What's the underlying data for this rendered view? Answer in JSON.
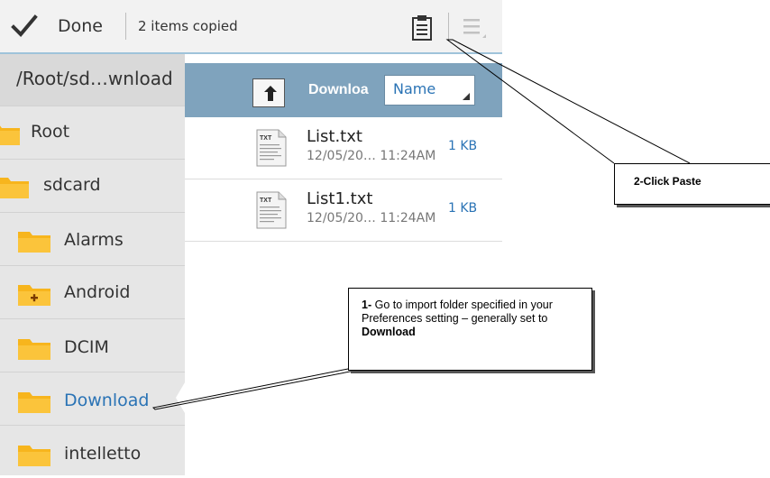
{
  "toolbar": {
    "done_label": "Done",
    "status": "2 items copied",
    "icons": [
      "checkmark-icon",
      "clipboard-paste-icon",
      "menu-icon"
    ]
  },
  "sidebar": {
    "path": "/Root/sd…wnload",
    "items": [
      {
        "label": "Root",
        "icon": "folder-icon"
      },
      {
        "label": "sdcard",
        "icon": "folder-icon"
      },
      {
        "label": "Alarms",
        "icon": "folder-icon"
      },
      {
        "label": "Android",
        "icon": "folder-plus-icon"
      },
      {
        "label": "DCIM",
        "icon": "folder-icon"
      },
      {
        "label": "Download",
        "icon": "folder-icon",
        "selected": true
      },
      {
        "label": "intelletto",
        "icon": "folder-icon"
      }
    ]
  },
  "content": {
    "folder_name": "Downloa",
    "sort": "Name",
    "files": [
      {
        "name": "List.txt",
        "date": "12/05/20… 11:24AM",
        "size": "1 KB",
        "icon_label": "TXT"
      },
      {
        "name": "List1.txt",
        "date": "12/05/20… 11:24AM",
        "size": "1 KB",
        "icon_label": "TXT"
      }
    ]
  },
  "callouts": {
    "paste": "2-Click Paste",
    "import_prefix": "1-",
    "import_body": " Go to import folder specified in your Preferences setting – generally set to ",
    "import_bold": "Download"
  },
  "colors": {
    "accent": "#2a73b5",
    "header_bar": "#7fa3bd",
    "toolbar_bg": "#f2f2f2",
    "sidebar_bg": "#e6e6e6",
    "folder": "#f7b51d"
  }
}
